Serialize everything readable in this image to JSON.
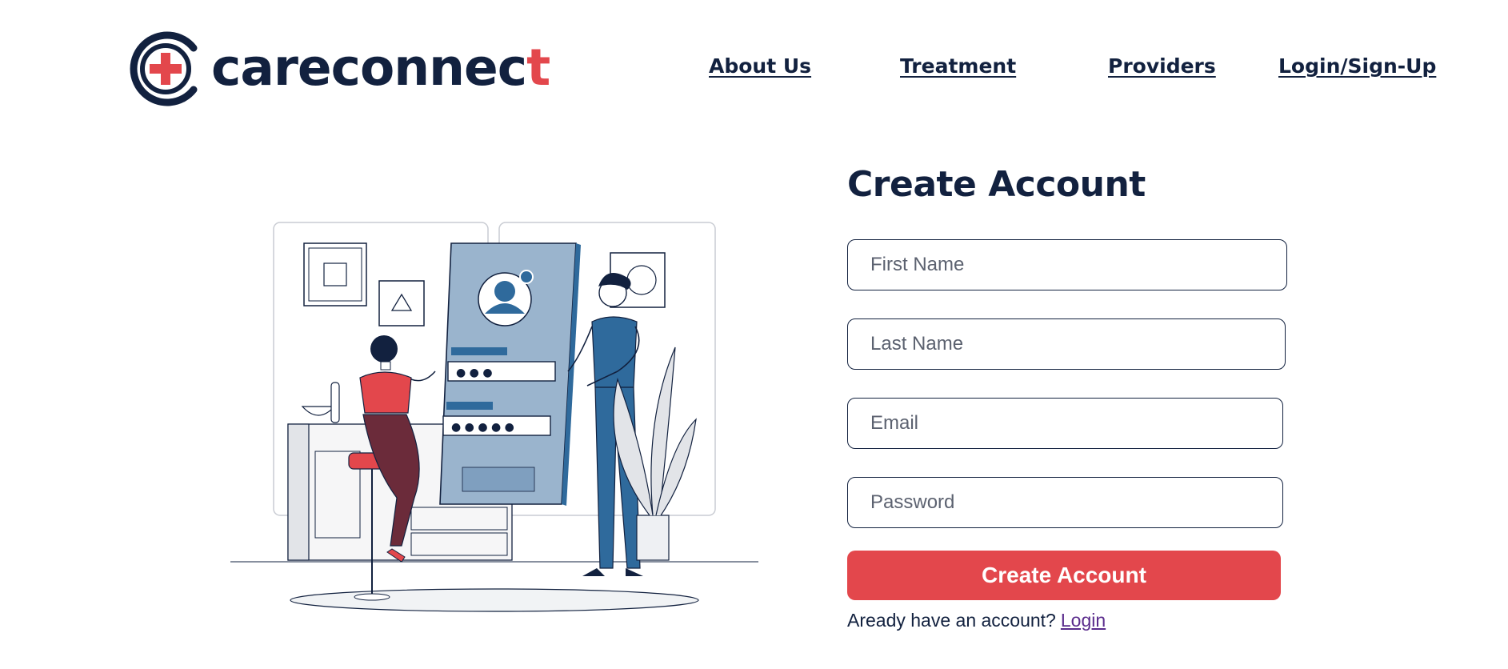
{
  "brand": {
    "name_main": "careconnec",
    "name_accent": "t",
    "colors": {
      "navy": "#12213f",
      "red": "#e3474c",
      "accent_blue": "#2f6a9c",
      "panel_blue": "#9ab4cd"
    }
  },
  "nav": {
    "items": [
      {
        "label": "About Us"
      },
      {
        "label": "Treatment"
      },
      {
        "label": "Providers"
      },
      {
        "label": "Login/Sign-Up"
      }
    ]
  },
  "illustration": {
    "icon": "signup-illustration",
    "dots_short": "● ● ●",
    "dots_long": "● ● ● ● ●"
  },
  "form": {
    "title": "Create Account",
    "fields": {
      "first_name": {
        "value": "",
        "placeholder": "First Name"
      },
      "last_name": {
        "value": "",
        "placeholder": "Last Name"
      },
      "email": {
        "value": "",
        "placeholder": "Email"
      },
      "password": {
        "value": "",
        "placeholder": "Password"
      }
    },
    "submit_label": "Create Account",
    "footer_text": "Aready have an account?",
    "footer_link": "Login"
  }
}
